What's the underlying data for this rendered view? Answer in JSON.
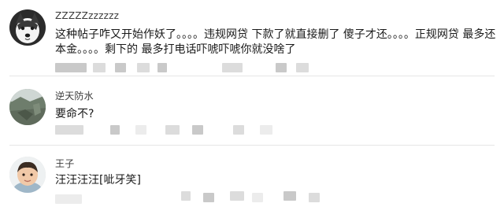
{
  "comments": [
    {
      "username": "ZZZZZzzzzzz",
      "text_line1": "这种帖子咋又开始作妖了。。。。违规网贷 下款了就直接删了 傻子才还。。。。正规网贷 最多还",
      "text_line2": "本金。。。。剩下的 最多打电话吓唬吓唬你就没啥了",
      "avatar": "husky-dog-avatar"
    },
    {
      "username": "逆天防水",
      "text_line1": "要命不?",
      "avatar": "landscape-photo-avatar"
    },
    {
      "username": "王子",
      "text_line1": "汪汪汪汪[呲牙笑]",
      "avatar": "child-photo-avatar"
    }
  ],
  "meta_obscured": "pixelated metadata (time, replies, likes)"
}
